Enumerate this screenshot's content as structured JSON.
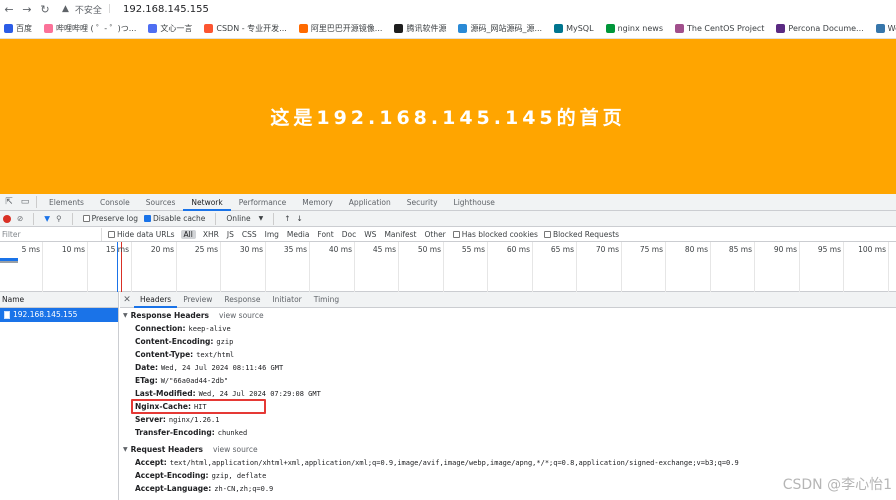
{
  "browser": {
    "nav": [
      "back-icon",
      "forward-icon",
      "reload-icon"
    ],
    "insecure_label": "不安全",
    "url": "192.168.145.155",
    "bookmarks": [
      {
        "label": "百度",
        "color": "#2b5ce6"
      },
      {
        "label": "哔哩哔哩 ( ゜- ゜)つ...",
        "color": "#fb7299"
      },
      {
        "label": "文心一言",
        "color": "#4e6ef2"
      },
      {
        "label": "CSDN - 专业开发...",
        "color": "#fc5531"
      },
      {
        "label": "阿里巴巴开源镜像...",
        "color": "#ff6a00"
      },
      {
        "label": "腾讯软件源",
        "color": "#1e1e1e"
      },
      {
        "label": "源码_网站源码_源...",
        "color": "#2a8ad6"
      },
      {
        "label": "MySQL",
        "color": "#00758f"
      },
      {
        "label": "nginx news",
        "color": "#009639"
      },
      {
        "label": "The CentOS Project",
        "color": "#a14f8c"
      },
      {
        "label": "Percona Docume...",
        "color": "#5a2a82"
      },
      {
        "label": "Welcome to",
        "color": "#3776ab"
      }
    ]
  },
  "page": {
    "heading": "这是192.168.145.145的首页",
    "bg": "#ffa500"
  },
  "devtools": {
    "tabs": [
      "Elements",
      "Console",
      "Sources",
      "Network",
      "Performance",
      "Memory",
      "Application",
      "Security",
      "Lighthouse"
    ],
    "active_tab": "Network",
    "toolbar": {
      "preserve_log": "Preserve log",
      "disable_cache": "Disable cache",
      "throttle": "Online"
    },
    "filter": {
      "placeholder": "Filter",
      "hide_data_urls": "Hide data URLs",
      "types": [
        "All",
        "XHR",
        "JS",
        "CSS",
        "Img",
        "Media",
        "Font",
        "Doc",
        "WS",
        "Manifest",
        "Other"
      ],
      "blocked_cookies": "Has blocked cookies",
      "blocked_requests": "Blocked Requests"
    },
    "timeline_ticks": [
      "5 ms",
      "10 ms",
      "15 ms",
      "20 ms",
      "25 ms",
      "30 ms",
      "35 ms",
      "40 ms",
      "45 ms",
      "50 ms",
      "55 ms",
      "60 ms",
      "65 ms",
      "70 ms",
      "75 ms",
      "80 ms",
      "85 ms",
      "90 ms",
      "95 ms",
      "100 ms"
    ],
    "name_header": "Name",
    "requests": [
      "192.168.145.155"
    ],
    "detail_tabs": [
      "Headers",
      "Preview",
      "Response",
      "Initiator",
      "Timing"
    ],
    "active_detail_tab": "Headers",
    "response_headers_title": "Response Headers",
    "view_source": "view source",
    "response_headers": [
      {
        "k": "Connection:",
        "v": "keep-alive"
      },
      {
        "k": "Content-Encoding:",
        "v": "gzip"
      },
      {
        "k": "Content-Type:",
        "v": "text/html"
      },
      {
        "k": "Date:",
        "v": "Wed, 24 Jul 2024 08:11:46 GMT"
      },
      {
        "k": "ETag:",
        "v": "W/\"66a0ad44-2db\""
      },
      {
        "k": "Last-Modified:",
        "v": "Wed, 24 Jul 2024 07:29:08 GMT"
      },
      {
        "k": "Nginx-Cache:",
        "v": "HIT"
      },
      {
        "k": "Server:",
        "v": "nginx/1.26.1"
      },
      {
        "k": "Transfer-Encoding:",
        "v": "chunked"
      }
    ],
    "request_headers_title": "Request Headers",
    "request_headers": [
      {
        "k": "Accept:",
        "v": "text/html,application/xhtml+xml,application/xml;q=0.9,image/avif,image/webp,image/apng,*/*;q=0.8,application/signed-exchange;v=b3;q=0.9"
      },
      {
        "k": "Accept-Encoding:",
        "v": "gzip, deflate"
      },
      {
        "k": "Accept-Language:",
        "v": "zh-CN,zh;q=0.9"
      }
    ]
  },
  "watermark": "CSDN @李心怡1"
}
